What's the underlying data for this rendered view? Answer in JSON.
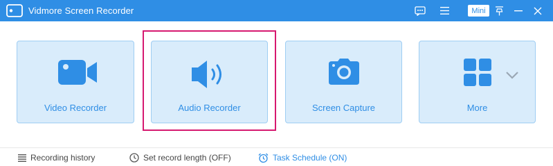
{
  "window": {
    "title": "Vidmore Screen Recorder",
    "mini_label": "Mini"
  },
  "cards": [
    {
      "label": "Video Recorder",
      "icon": "video-camera-icon"
    },
    {
      "label": "Audio Recorder",
      "icon": "speaker-icon"
    },
    {
      "label": "Screen Capture",
      "icon": "camera-icon"
    },
    {
      "label": "More",
      "icon": "grid-icon"
    }
  ],
  "footer": {
    "history_label": "Recording history",
    "length_label": "Set record length (OFF)",
    "schedule_label": "Task Schedule (ON)"
  },
  "colors": {
    "accent": "#2f8ee5",
    "card_bg": "#d9ecfb",
    "highlight": "#d6186f"
  }
}
